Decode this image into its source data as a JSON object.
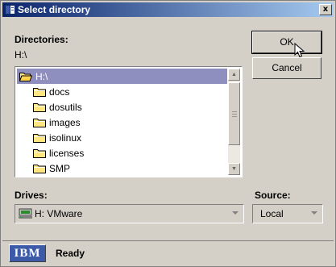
{
  "window": {
    "title": "Select directory",
    "close_label": "x"
  },
  "directories": {
    "label": "Directories:",
    "current_path": "H:\\",
    "items": [
      {
        "label": "H:\\",
        "root": true
      },
      {
        "label": "docs"
      },
      {
        "label": "dosutils"
      },
      {
        "label": "images"
      },
      {
        "label": "isolinux"
      },
      {
        "label": "licenses"
      },
      {
        "label": "SMP"
      }
    ]
  },
  "buttons": {
    "ok_label": "OK",
    "cancel_label": "Cancel"
  },
  "drives": {
    "label": "Drives:",
    "selected": "H:  VMware"
  },
  "source": {
    "label": "Source:",
    "selected": "Local"
  },
  "status": {
    "logo_text": "IBM",
    "text": "Ready"
  },
  "colors": {
    "title_start": "#0a246a",
    "title_end": "#a6caf0",
    "selection": "#8f8fbf",
    "ibm_blue": "#3d5aa8"
  }
}
